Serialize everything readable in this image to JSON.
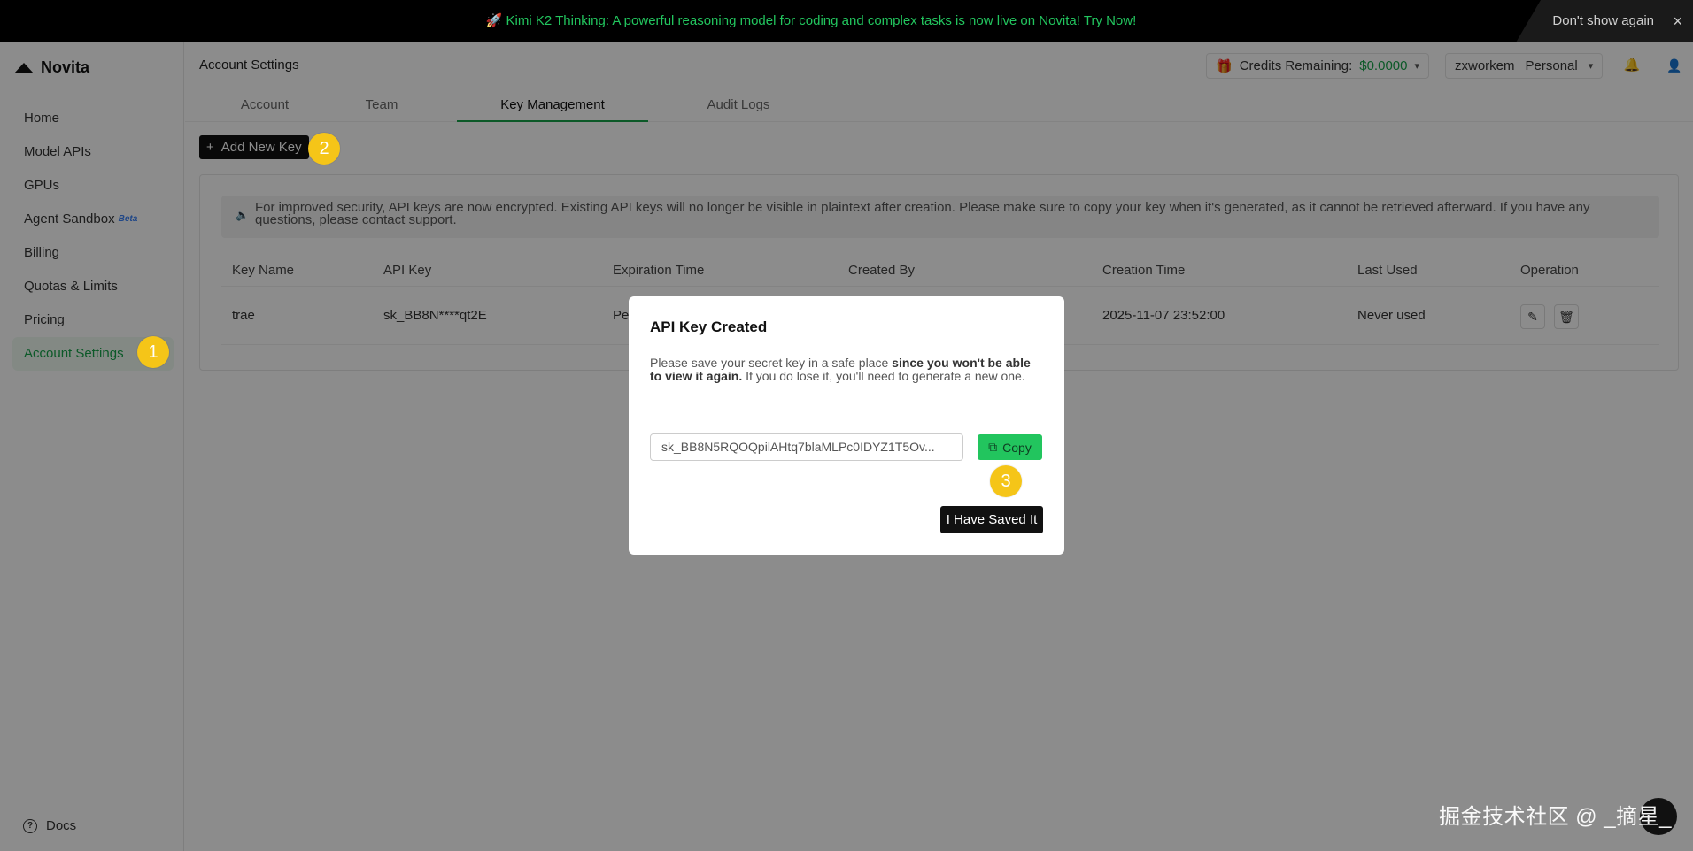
{
  "banner": {
    "text": "🚀 Kimi K2 Thinking: A powerful reasoning model for coding and complex tasks is now live on Novita! Try Now!",
    "dont_show": "Don't show again",
    "close": "×"
  },
  "sidebar": {
    "logo": "Novita",
    "items": [
      {
        "label": "Home"
      },
      {
        "label": "Model APIs"
      },
      {
        "label": "GPUs"
      },
      {
        "label": "Agent Sandbox",
        "badge": "Beta"
      },
      {
        "label": "Billing"
      },
      {
        "label": "Quotas & Limits"
      },
      {
        "label": "Pricing"
      },
      {
        "label": "Account Settings"
      }
    ],
    "docs": "Docs"
  },
  "header": {
    "title": "Account Settings",
    "credits_label": "Credits Remaining:",
    "credits_value": "$0.0000",
    "username": "zxworkem",
    "workspace": "Personal"
  },
  "tabs": [
    "Account",
    "Team",
    "Key Management",
    "Audit Logs"
  ],
  "main": {
    "add_key_label": "Add New Key",
    "notice": "For improved security, API keys are now encrypted. Existing API keys will no longer be visible in plaintext after creation. Please make sure to copy your key when it's generated, as it cannot be retrieved afterward. If you have any questions, please contact support.",
    "columns": [
      "Key Name",
      "API Key",
      "Expiration Time",
      "Created By",
      "Creation Time",
      "Last Used",
      "Operation"
    ],
    "rows": [
      {
        "key_name": "trae",
        "api_key": "sk_BB8N****qt2E",
        "expiration": "Pe",
        "created_by": "",
        "creation_time": "2025-11-07 23:52:00",
        "last_used": "Never used"
      }
    ]
  },
  "modal": {
    "title": "API Key Created",
    "desc_1": "Please save your secret key in a safe place ",
    "desc_bold": "since you won't be able to view it again.",
    "desc_2": " If you do lose it, you'll need to generate a new one.",
    "key_value": "sk_BB8N5RQOQpilAHtq7blaMLPc0IDYZ1T5Ov...",
    "copy_label": "Copy",
    "saved_label": "I Have Saved It"
  },
  "steps": [
    "1",
    "2",
    "3"
  ],
  "watermark": "掘金技术社区 @ _摘星_",
  "colors": {
    "accent": "#22c55e",
    "step": "#f5c518"
  }
}
